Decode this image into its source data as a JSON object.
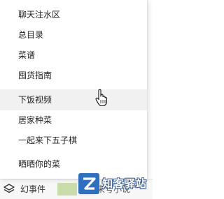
{
  "menu": {
    "items": [
      {
        "label": "聊天注水区"
      },
      {
        "label": "总目录"
      },
      {
        "label": "菜谱"
      },
      {
        "label": "囤货指南"
      },
      {
        "label": "下饭视频"
      },
      {
        "label": "居家种菜"
      },
      {
        "label": "一起来下五子棋"
      },
      {
        "label": "晒晒你的菜"
      }
    ],
    "hovered_item": "下饭视频"
  },
  "bottom_bar": {
    "label": "幻事件",
    "underlying_text": "来号小说",
    "layers_icon": "layers-icon"
  },
  "cursor": {
    "icon": "hand-pointer-icon"
  },
  "watermark": {
    "text": "知客驿站",
    "icon": "z-logo-icon",
    "color": "#2e6fbf"
  }
}
